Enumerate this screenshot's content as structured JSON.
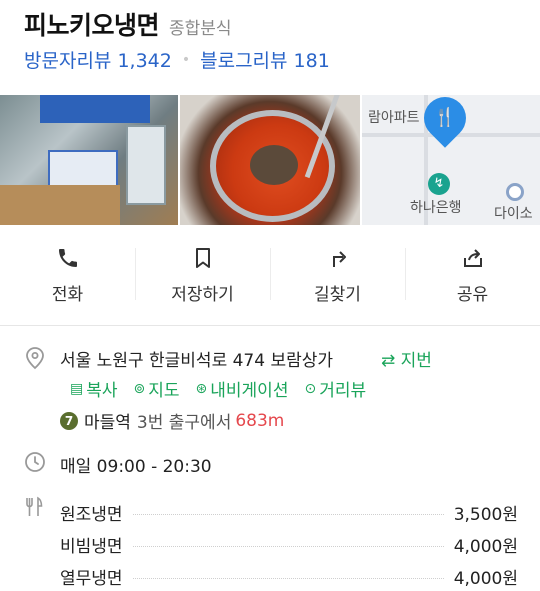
{
  "place": {
    "title": "피노키오냉면",
    "category": "종합분식"
  },
  "reviews": {
    "visitor": "방문자리뷰 1,342",
    "blog": "블로그리뷰 181"
  },
  "photos": {
    "map_labels": {
      "apartment": "람아파트",
      "bank": "하나은행",
      "store": "다이소"
    }
  },
  "actions": [
    {
      "label": "전화",
      "icon": "phone-icon"
    },
    {
      "label": "저장하기",
      "icon": "bookmark-icon"
    },
    {
      "label": "길찾기",
      "icon": "directions-icon"
    },
    {
      "label": "공유",
      "icon": "share-icon"
    }
  ],
  "info": {
    "address": "서울 노원구 한글비석로 474 보람상가",
    "jibun": "⇄ 지번",
    "links": [
      {
        "label": "복사",
        "icon": "copy-icon"
      },
      {
        "label": "지도",
        "icon": "map-pin-icon"
      },
      {
        "label": "내비게이션",
        "icon": "navigation-icon"
      },
      {
        "label": "거리뷰",
        "icon": "street-view-icon"
      }
    ],
    "subway": {
      "line": "7",
      "line_color": "#5a6e2e",
      "station": "마들역",
      "exit": "3번 출구에서",
      "distance": "683m"
    },
    "hours": "매일 09:00 - 20:30"
  },
  "menu": [
    {
      "name": "원조냉면",
      "price": "3,500원"
    },
    {
      "name": "비빔냉면",
      "price": "4,000원"
    },
    {
      "name": "열무냉면",
      "price": "4,000원"
    }
  ],
  "colors": {
    "review_link": "#2a64c8",
    "green_link": "#1aa45a",
    "distance": "#e5484d"
  }
}
